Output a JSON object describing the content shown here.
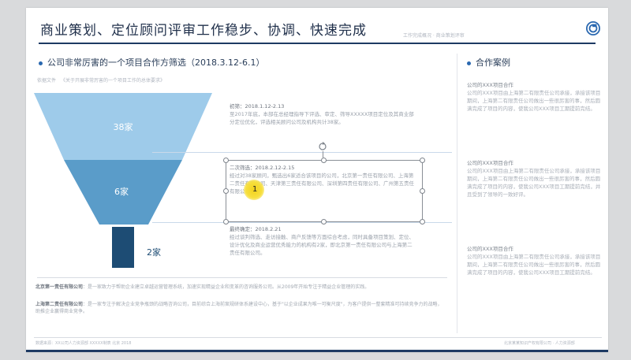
{
  "header": {
    "title": "商业策划、定位顾问评审工作稳步、协调、快速完成",
    "subtitle": "工作完成概况 · 商业策划评审"
  },
  "left": {
    "section_title": "公司非常厉害的一个项目合作方筛选（2018.3.12-6.1）",
    "basis_label": "依据文件",
    "basis_text": "《关于开展非常厉害的一个项目工作的总体要求》",
    "funnel": [
      {
        "label": "38家",
        "color": "#9ecbea"
      },
      {
        "label": "6家",
        "color": "#5a9cc9"
      },
      {
        "label": "2家",
        "color": "#1d4c74"
      }
    ],
    "stages": [
      {
        "title": "初筛：2018.1.12-2.13",
        "text": "至2017年底，本部在总经理指导下评选、审定、筛导XXXXX项目定位及其商业部分定位优化，评选相关顾问公司及机构共计38家。"
      },
      {
        "title": "二次筛选：2018.2.12-2.15",
        "text": "经过对38家顾问，甄选出6家适合该项目的公司，北京第一责任有限公司、上海第二责任有限公司、天津第三责任有限公司、深圳第四责任有限公司、广州第五责任有限公司。"
      },
      {
        "title": "最终确定：2018.2.21",
        "text": "经过谈判筛选、走访接触、商户反馈等方面综合考虑，同时具备项目策划、定位、设计优化及商业运营优秀能力的机构有2家，即北京第一责任有限公司与上海第二责任有限公司。"
      }
    ],
    "companies": [
      {
        "name": "北京第一责任有限公司",
        "text": "：是一家致力于帮助企业建立卓越运营管理系统，加速实现精益企业和变革的咨询服务公司。从2009年开始专注于精益企业管理的实践。"
      },
      {
        "name": "上海第二责任有限公司",
        "text": "：是一家专注于解决企业竞争瓶颈的战略咨询公司，目前综合上海前案规研体系建设中心，基于\"以企业成果为唯一可衡尺度\"，为客户提供一整套精准可持续竞争力的战略，助推企业赢得商业竞争。"
      }
    ],
    "cursor_mark": "1"
  },
  "right": {
    "section_title": "合作案例",
    "cases": [
      {
        "title": "公司的XXX项目合作",
        "text": "公司的XXX项目由上海第二有限责任公司承接，承接该项目期间，上海第二有限责任公司做出一些很厉害的事，然后圆满完成了项目的内容，使我公司XXX项目工期提前完结。"
      },
      {
        "title": "公司的XXX项目合作",
        "text": "公司的XXX项目由上海第二有限责任公司承接，承接该项目期间，上海第二有限责任公司做出一些很厉害的事，然后圆满完成了项目的内容，使我公司XXX项目工期提前完结，并且受到了领导的一致好评。"
      },
      {
        "title": "公司的XXX项目合作",
        "text": "公司的XXX项目由上海第二有限责任公司承接，承接该项目期间，上海第二有限责任公司做出一些很厉害的事，然后圆满完成了项目的内容，使我公司XXX项目工期提前完结。"
      }
    ]
  },
  "footer": {
    "left": "数据来源：XX公司人力资源部 XXXXX制表 北京 2018",
    "right": "北京某某知识产权有限公司 · 人力资源部"
  }
}
